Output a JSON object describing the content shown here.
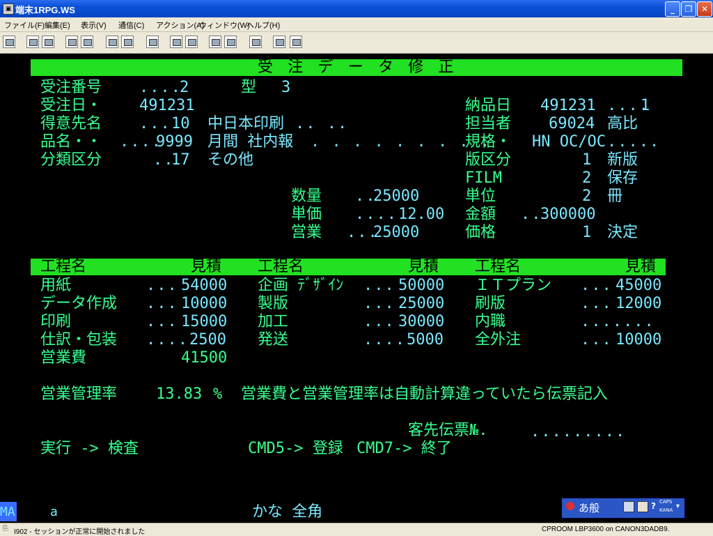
{
  "window": {
    "title": "端末1RPG.WS"
  },
  "menu": [
    "ファイル(F)",
    "編集(E)",
    "表示(V)",
    "通信(C)",
    "アクション(A)",
    "ウィンドウ(W)",
    "ヘルプ(H)"
  ],
  "screen": {
    "header": "受 注 デ ー タ 修 正",
    "order_no_label": "受注番号",
    "order_no": "2",
    "type_label": "型",
    "type_value": "3",
    "order_date_label": "受注日・",
    "order_date": "491231",
    "delivery_label": "納品日",
    "delivery_date": "491231",
    "delivery_suffix": "1",
    "customer_label": "得意先名",
    "customer_code": "10",
    "customer_name": "中日本印刷",
    "manager_label": "担当者",
    "manager_code": "69024",
    "manager_name": "高比",
    "product_label": "品名・・",
    "product_code": "9999",
    "product_name": "月間 社内報",
    "spec_label": "規格・",
    "spec_value": "HN OC/OC",
    "category_label": "分類区分",
    "category_code": "17",
    "category_name": "その他",
    "plate_label": "版区分",
    "plate_code": "1",
    "plate_name": "新版",
    "film_label": "FILM",
    "film_code": "2",
    "film_name": "保存",
    "qty_label": "数量",
    "qty_value": "25000",
    "unit_label": "単位",
    "unit_code": "2",
    "unit_name": "冊",
    "price_label": "単価",
    "price_value": "12.00",
    "amount_label": "金額",
    "amount_value": "300000",
    "sales_label": "営業",
    "sales_value": "25000",
    "kakaku_label": "価格",
    "kakaku_code": "1",
    "kakaku_name": "決定",
    "process_header": {
      "name1": "工程名",
      "est1": "見積",
      "name2": "工程名",
      "est2": "見積",
      "name3": "工程名",
      "est3": "見積"
    },
    "col1": [
      {
        "name": "用紙",
        "value": "54000"
      },
      {
        "name": "データ作成",
        "value": "10000"
      },
      {
        "name": "印刷",
        "value": "15000"
      },
      {
        "name": "仕訳・包装",
        "value": "2500"
      }
    ],
    "col2": [
      {
        "name": "企画 ﾃﾞｻﾞｲﾝ",
        "value": "50000"
      },
      {
        "name": "製版",
        "value": "25000"
      },
      {
        "name": "加工",
        "value": "30000"
      },
      {
        "name": "発送",
        "value": "5000"
      }
    ],
    "col3": [
      {
        "name": "ＩＴプラン",
        "value": "45000"
      },
      {
        "name": "刷版",
        "value": "12000"
      },
      {
        "name": "内職",
        "value": ""
      },
      {
        "name": "全外注",
        "value": "10000"
      }
    ],
    "sales_cost_label": "営業費",
    "sales_cost_value": "41500",
    "mgmt_rate_label": "営業管理率",
    "mgmt_rate_value": "13.83",
    "mgmt_rate_unit": "%",
    "mgmt_note": "営業費と営業管理率は自動計算違っていたら伝票記入",
    "slip_label": "客先伝票№.",
    "exec_label": "実行 -> 検査",
    "cmd5_label": "CMD5-> 登録",
    "cmd7_label": "CMD7-> 終了",
    "mode_ma": "MA",
    "mode_a": "a",
    "kana_mode": "かな 全角"
  },
  "ime": {
    "label": "あ般",
    "caps": "CAPS",
    "kana": "KANA"
  },
  "status": {
    "message": "I902 - セッションが正常に開始されました",
    "printer": "CPROOM LBP3600 on CANON3DADB9."
  }
}
